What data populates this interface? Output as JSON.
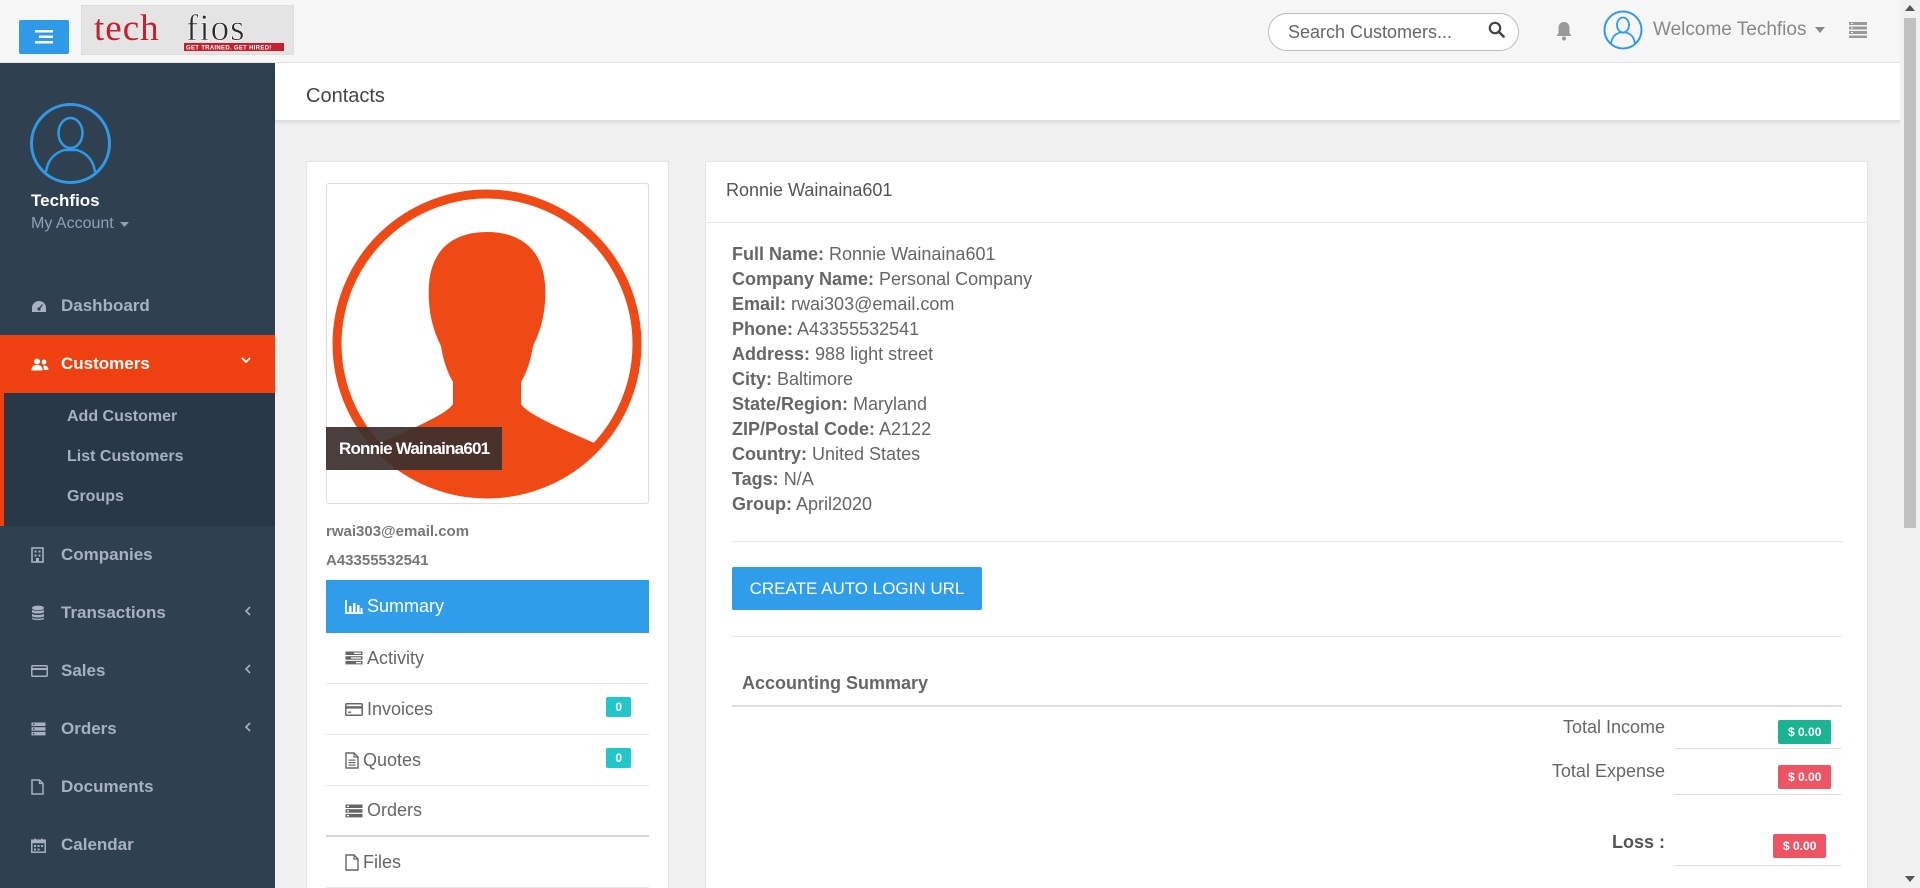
{
  "topbar": {
    "logo_text": "techfios",
    "logo_tagline": "GET TRAINED. GET HIRED!",
    "search_placeholder": "Search Customers...",
    "welcome": "Welcome Techfios"
  },
  "sidebar": {
    "profile_name": "Techfios",
    "my_account": "My Account",
    "items": [
      {
        "label": "Dashboard",
        "icon": "dashboard-icon"
      },
      {
        "label": "Customers",
        "icon": "users-icon"
      },
      {
        "label": "Companies",
        "icon": "building-icon"
      },
      {
        "label": "Transactions",
        "icon": "database-icon"
      },
      {
        "label": "Sales",
        "icon": "credit-card-icon"
      },
      {
        "label": "Orders",
        "icon": "server-icon"
      },
      {
        "label": "Documents",
        "icon": "file-icon"
      },
      {
        "label": "Calendar",
        "icon": "calendar-icon"
      }
    ],
    "customers_sub": [
      "Add Customer",
      "List Customers",
      "Groups"
    ]
  },
  "page": {
    "title": "Contacts"
  },
  "contact": {
    "name_tag": "Ronnie Wainaina601",
    "email": "rwai303@email.com",
    "phone": "A43355532541",
    "menu": [
      {
        "label": "Summary",
        "icon": "bar-chart-icon"
      },
      {
        "label": "Activity",
        "icon": "tasks-icon"
      },
      {
        "label": "Invoices",
        "icon": "credit-card-icon",
        "badge": "0"
      },
      {
        "label": "Quotes",
        "icon": "file-text-icon",
        "badge": "0"
      },
      {
        "label": "Orders",
        "icon": "server-icon"
      },
      {
        "label": "Files",
        "icon": "file-icon"
      }
    ]
  },
  "details": {
    "header": "Ronnie Wainaina601",
    "rows": [
      {
        "label": "Full Name:",
        "value": "Ronnie Wainaina601"
      },
      {
        "label": "Company Name:",
        "value": "Personal Company"
      },
      {
        "label": "Email:",
        "value": "rwai303@email.com"
      },
      {
        "label": "Phone:",
        "value": "A43355532541"
      },
      {
        "label": "Address:",
        "value": "988 light street"
      },
      {
        "label": "City:",
        "value": "Baltimore"
      },
      {
        "label": "State/Region:",
        "value": "Maryland"
      },
      {
        "label": "ZIP/Postal Code:",
        "value": "A2122"
      },
      {
        "label": "Country:",
        "value": "United States"
      },
      {
        "label": "Tags:",
        "value": "N/A"
      },
      {
        "label": "Group:",
        "value": "April2020"
      }
    ],
    "auto_login_button": "CREATE AUTO LOGIN URL"
  },
  "accounting": {
    "title": "Accounting Summary",
    "total_income_label": "Total Income",
    "total_income": "$ 0.00",
    "total_expense_label": "Total Expense",
    "total_expense": "$ 0.00",
    "loss_label": "Loss :",
    "loss": "$ 0.00",
    "colors": {
      "income": "#1ab394",
      "expense": "#ed5565"
    }
  }
}
